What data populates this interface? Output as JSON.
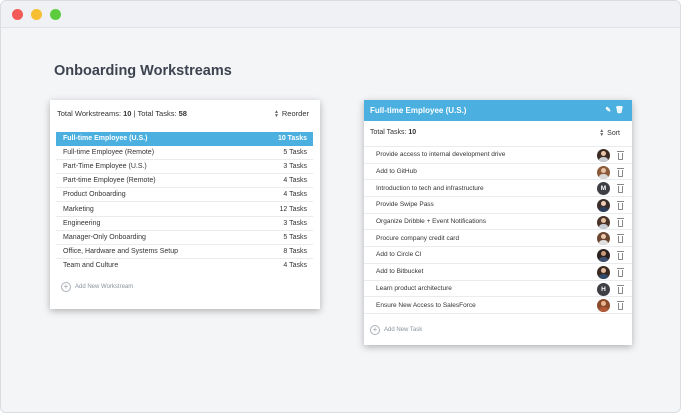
{
  "window": {
    "controls": [
      "close",
      "minimize",
      "maximize"
    ],
    "colors": {
      "close": "#f25b58",
      "minimize": "#f6be30",
      "maximize": "#5ccc3e"
    }
  },
  "page": {
    "title": "Onboarding Workstreams"
  },
  "colors": {
    "accent": "#4bb0e0"
  },
  "workstreams_panel": {
    "total_workstreams_label": "Total Workstreams:",
    "total_workstreams_value": "10",
    "separator": "|",
    "total_tasks_label": "Total Tasks:",
    "total_tasks_value": "58",
    "reorder_label": "Reorder",
    "items": [
      {
        "name": "Full-time Employee (U.S.)",
        "tasks": "10 Tasks",
        "active": true
      },
      {
        "name": "Full-time Employee (Remote)",
        "tasks": "5 Tasks",
        "active": false
      },
      {
        "name": "Part-Time Employee (U.S.)",
        "tasks": "3 Tasks",
        "active": false
      },
      {
        "name": "Part-time Employee (Remote)",
        "tasks": "4 Tasks",
        "active": false
      },
      {
        "name": "Product Onboarding",
        "tasks": "4 Tasks",
        "active": false
      },
      {
        "name": "Marketing",
        "tasks": "12 Tasks",
        "active": false
      },
      {
        "name": "Engineering",
        "tasks": "3 Tasks",
        "active": false
      },
      {
        "name": "Manager-Only Onboarding",
        "tasks": "5 Tasks",
        "active": false
      },
      {
        "name": "Office, Hardware and Systems Setup",
        "tasks": "8 Tasks",
        "active": false
      },
      {
        "name": "Team and Culture",
        "tasks": "4 Tasks",
        "active": false
      }
    ],
    "add_label": "Add New Workstream"
  },
  "tasks_panel": {
    "title": "Full-time Employee (U.S.)",
    "header_icons": [
      "edit-icon",
      "trash-icon"
    ],
    "total_tasks_label": "Total Tasks:",
    "total_tasks_value": "10",
    "sort_label": "Sort",
    "tasks": [
      {
        "name": "Provide access to internal development drive",
        "avatar": {
          "type": "photo",
          "skin": "#e8c4a8",
          "hair": "#3a2a22",
          "shirt": "#c9ccd1"
        }
      },
      {
        "name": "Add to GitHub",
        "avatar": {
          "type": "photo",
          "skin": "#e9c2a6",
          "hair": "#8a5a3a",
          "shirt": "#d8d8d8"
        }
      },
      {
        "name": "Introduction to tech and infrastructure",
        "avatar": {
          "type": "letter",
          "letter": "M"
        }
      },
      {
        "name": "Provide Swipe Pass",
        "avatar": {
          "type": "photo",
          "skin": "#f0cfb8",
          "hair": "#3b2e2a",
          "shirt": "#2d3e5a"
        }
      },
      {
        "name": "Organize Dribble + Event Notifications",
        "avatar": {
          "type": "photo",
          "skin": "#e6c0a0",
          "hair": "#4a3328",
          "shirt": "#c8ccd4"
        }
      },
      {
        "name": "Procure company credit card",
        "avatar": {
          "type": "photo",
          "skin": "#eec8ac",
          "hair": "#6b4630",
          "shirt": "#e0e0e0"
        }
      },
      {
        "name": "Add to Circle CI",
        "avatar": {
          "type": "photo",
          "skin": "#c99a7a",
          "hair": "#2b2220",
          "shirt": "#3d5070"
        }
      },
      {
        "name": "Add to Bitbucket",
        "avatar": {
          "type": "photo",
          "skin": "#e4bb9c",
          "hair": "#3a2a22",
          "shirt": "#324a6a"
        }
      },
      {
        "name": "Learn product architecture",
        "avatar": {
          "type": "letter",
          "letter": "H"
        }
      },
      {
        "name": "Ensure New Access to SalesForce",
        "avatar": {
          "type": "photo",
          "skin": "#e8b690",
          "hair": "#8b4a2a",
          "shirt": "#b05a3a"
        }
      }
    ],
    "add_label": "Add New Task"
  }
}
